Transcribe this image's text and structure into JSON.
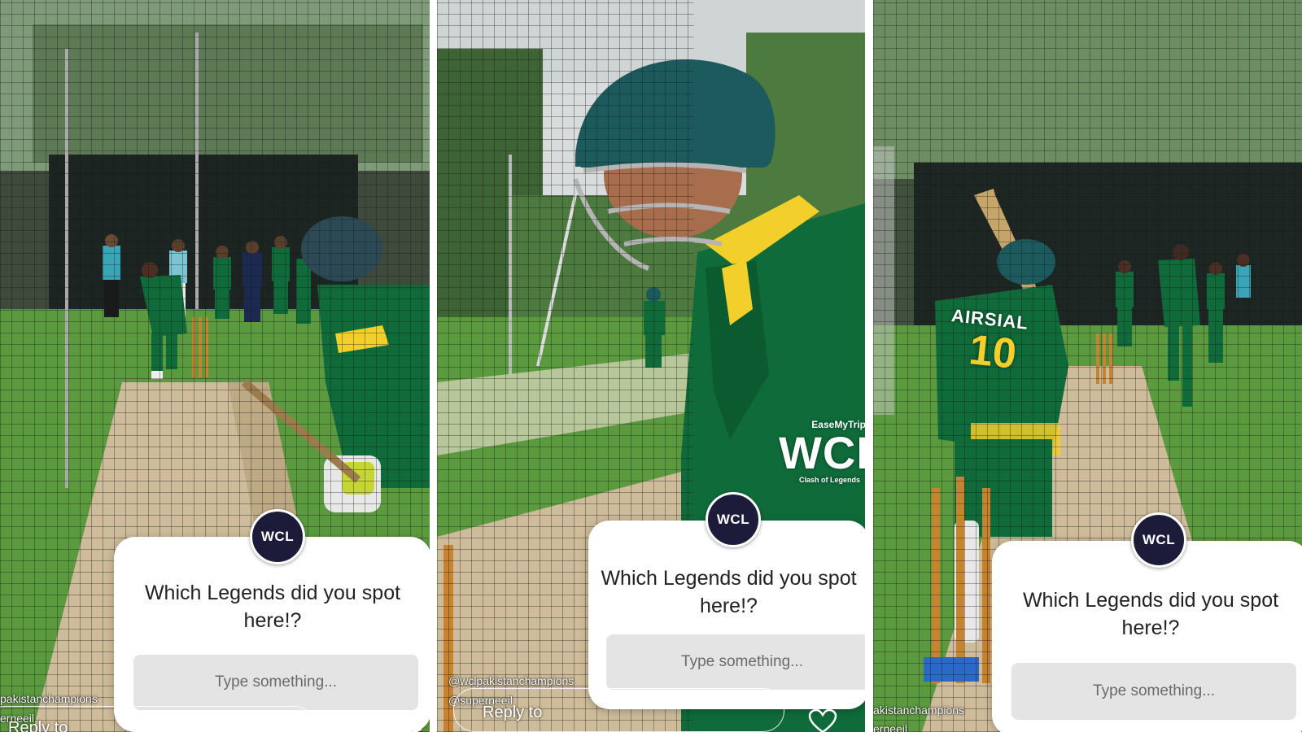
{
  "stories": [
    {
      "question": "Which Legends did you spot here!?",
      "input_placeholder": "Type something...",
      "logo_text": "WCL",
      "handle_1": "pakistanchampions",
      "handle_2": "erneeil",
      "reply_label": "Reply to"
    },
    {
      "question": "Which Legends did you spot here!?",
      "input_placeholder": "Type something...",
      "logo_text": "WCL",
      "handle_1": "@wclpakistanchampions",
      "handle_2": "@superneeil",
      "reply_label": "Reply to",
      "watermark_sponsor": "EaseMyTrip",
      "watermark_brand": "WCL",
      "watermark_tagline": "Clash of Legends"
    },
    {
      "question": "Which Legends did you spot here!?",
      "input_placeholder": "Type something...",
      "logo_text": "WCL",
      "handle_1": "akistanchampions",
      "handle_2": "erneeil",
      "jersey_sponsor": "AIRSIAL",
      "jersey_number": "10"
    }
  ],
  "colors": {
    "jersey_green": "#0f6b3a",
    "jersey_yellow": "#f2cf2b",
    "helmet_teal": "#1c5a5e",
    "pitch_beige": "#cdbb99",
    "grass_green": "#5c9a3f",
    "card_bg": "#ffffff",
    "input_bg": "#e4e4e4"
  },
  "icons": [
    "heart-icon",
    "send-icon",
    "wcl-logo-icon"
  ]
}
